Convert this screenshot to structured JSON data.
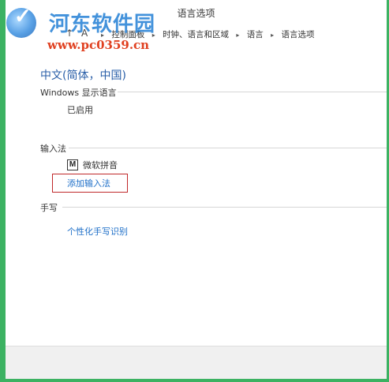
{
  "window": {
    "title": "语言选项"
  },
  "watermark": {
    "site_name": "河东软件园",
    "url": "www.pc0359.cn",
    "logo_glyph": "✓"
  },
  "nav": {
    "up_arrow": "↑",
    "control_panel_icon": "A",
    "breadcrumb": [
      "控制面板",
      "时钟、语言和区域",
      "语言",
      "语言选项"
    ],
    "separator": "▸"
  },
  "main": {
    "language_title": "中文(简体，中国)",
    "windows_display_language": {
      "heading": "Windows 显示语言",
      "status": "已启用"
    },
    "input_method": {
      "heading": "输入法",
      "ime_icon_letter": "M",
      "ime_name": "微软拼音",
      "add_link": "添加输入法"
    },
    "handwriting": {
      "heading": "手写",
      "personalize_link": "个性化手写识别"
    }
  },
  "colors": {
    "frame_accent": "#3cb262",
    "link": "#1e6fc8",
    "title_blue": "#2a5fa8",
    "highlight_box": "#c0282a"
  }
}
